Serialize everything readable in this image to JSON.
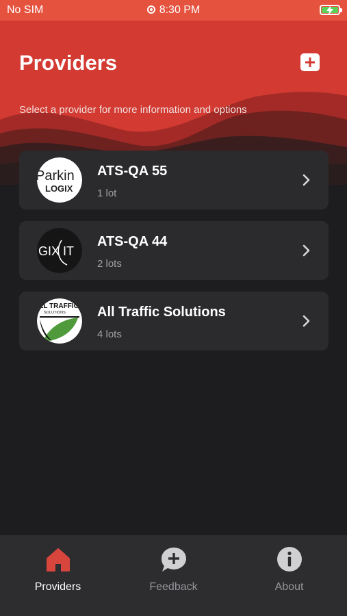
{
  "status_bar": {
    "carrier": "No SIM",
    "time": "8:30 PM"
  },
  "header": {
    "title": "Providers",
    "subtitle": "Select a provider for more information and options",
    "add_icon": "plus-square-icon"
  },
  "providers": [
    {
      "name": "ATS-QA 55",
      "lots": "1 lot",
      "logo": "parkingLogix-logo",
      "logo_text_1": "Parkin",
      "logo_text_2": "LOGIX"
    },
    {
      "name": "ATS-QA 44",
      "lots": "2 lots",
      "logo": "gixit-logo",
      "logo_text_1": "GIX IT"
    },
    {
      "name": "All Traffic Solutions",
      "lots": "4 lots",
      "logo": "all-traffic-solutions-logo",
      "logo_text_1": "ALL TRAFFIC",
      "logo_text_2": "SOLUTIONS"
    }
  ],
  "tabs": [
    {
      "label": "Providers",
      "icon": "house-icon",
      "active": true
    },
    {
      "label": "Feedback",
      "icon": "speech-bubble-plus-icon",
      "active": false
    },
    {
      "label": "About",
      "icon": "info-circle-icon",
      "active": false
    }
  ],
  "colors": {
    "accent": "#e5533f",
    "header_red": "#d23a32",
    "background": "#1d1d1f",
    "card": "#2b2b2e",
    "tabbar": "#2d2d30",
    "active_tab_icon": "#d7453d",
    "inactive_tab": "#97979b"
  }
}
